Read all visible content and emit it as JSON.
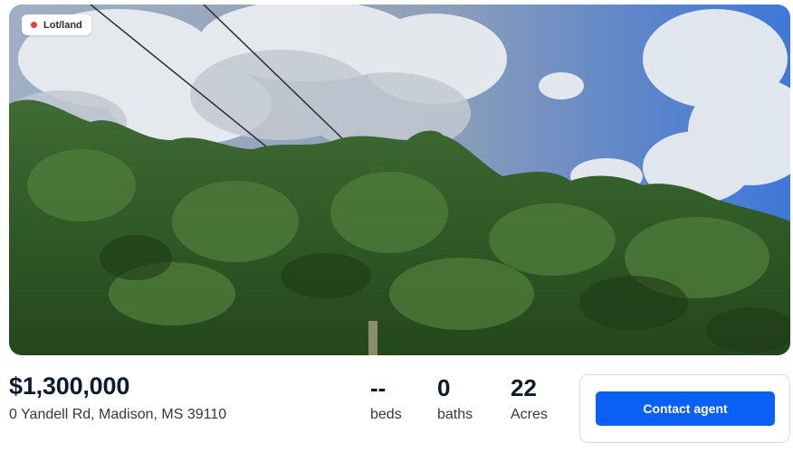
{
  "listing": {
    "type_badge": "Lot/land",
    "price": "$1,300,000",
    "address": "0 Yandell Rd, Madison, MS 39110",
    "stats": {
      "beds": {
        "value": "--",
        "label": "beds"
      },
      "baths": {
        "value": "0",
        "label": "baths"
      },
      "acres": {
        "value": "22",
        "label": "Acres"
      }
    },
    "contact_label": "Contact agent"
  },
  "colors": {
    "accent": "#0a5ff5",
    "badge_dot": "#e0413a",
    "text_primary": "#0d1b2a"
  },
  "photo": {
    "subject": "trees-under-cloudy-sky"
  }
}
